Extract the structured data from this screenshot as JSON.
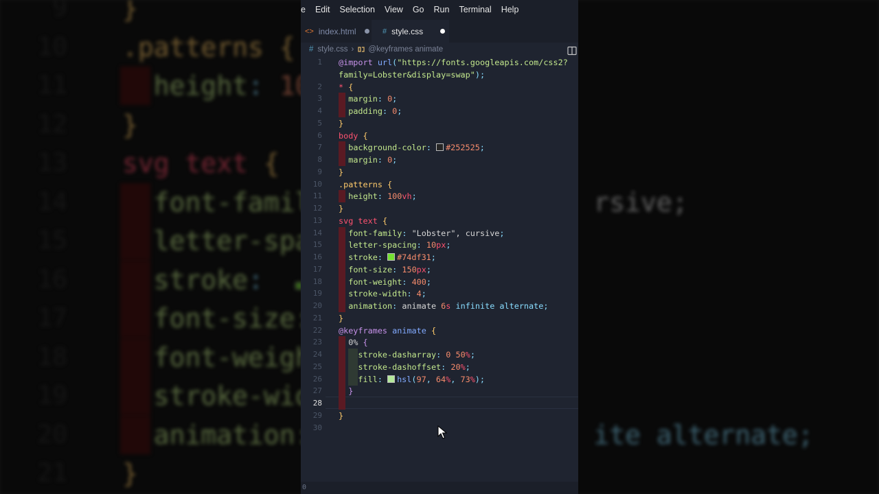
{
  "menu": [
    "e",
    "Edit",
    "Selection",
    "View",
    "Go",
    "Run",
    "Terminal",
    "Help"
  ],
  "tabs": [
    {
      "label": "index.html",
      "icon": "<>",
      "dot_color": "#8a93a8"
    },
    {
      "label": "style.css",
      "icon": "#",
      "dot_color": "#ffffff"
    }
  ],
  "breadcrumb": {
    "file": "style.css",
    "symbol": "@keyframes animate"
  },
  "current_line": 28,
  "status": {
    "left": "0"
  },
  "colors": {
    "editor_bg": "#1f2430",
    "accent": "#ffcb6b",
    "swatch_bg": "#252525",
    "swatch_stroke": "#74df31",
    "swatch_fill": "#b4e89a"
  },
  "code_lines": [
    {
      "n": "1",
      "t": [
        [
          "t-at",
          "@import"
        ],
        [
          "t-txt",
          " "
        ],
        [
          "t-fn",
          "url"
        ],
        [
          "t-pun",
          "("
        ],
        [
          "t-str",
          "\"https://fonts.googleapis.com/css2?"
        ]
      ]
    },
    {
      "n": "",
      "t": [
        [
          "t-str",
          "family=Lobster&display=swap\""
        ],
        [
          "t-pun",
          ");"
        ]
      ]
    },
    {
      "n": "2",
      "t": [
        [
          "t-sel",
          "*"
        ],
        [
          "t-txt",
          " "
        ],
        [
          "t-br",
          "{"
        ]
      ]
    },
    {
      "n": "3",
      "t": [
        [
          "t-txt",
          "  "
        ],
        [
          "t-prop",
          "margin"
        ],
        [
          "t-pun",
          ":"
        ],
        [
          "t-txt",
          " "
        ],
        [
          "t-num",
          "0"
        ],
        [
          "t-pun",
          ";"
        ]
      ]
    },
    {
      "n": "4",
      "t": [
        [
          "t-txt",
          "  "
        ],
        [
          "t-prop",
          "padding"
        ],
        [
          "t-pun",
          ":"
        ],
        [
          "t-txt",
          " "
        ],
        [
          "t-num",
          "0"
        ],
        [
          "t-pun",
          ";"
        ]
      ]
    },
    {
      "n": "5",
      "t": [
        [
          "t-br",
          "}"
        ]
      ]
    },
    {
      "n": "6",
      "t": [
        [
          "t-sel",
          "body"
        ],
        [
          "t-txt",
          " "
        ],
        [
          "t-br",
          "{"
        ]
      ]
    },
    {
      "n": "7",
      "t": [
        [
          "t-txt",
          "  "
        ],
        [
          "t-prop",
          "background-color"
        ],
        [
          "t-pun",
          ":"
        ],
        [
          "t-txt",
          " "
        ],
        [
          "sw",
          "#252525"
        ],
        [
          "t-num",
          "#252525"
        ],
        [
          "t-pun",
          ";"
        ]
      ]
    },
    {
      "n": "8",
      "t": [
        [
          "t-txt",
          "  "
        ],
        [
          "t-prop",
          "margin"
        ],
        [
          "t-pun",
          ":"
        ],
        [
          "t-txt",
          " "
        ],
        [
          "t-num",
          "0"
        ],
        [
          "t-pun",
          ";"
        ]
      ]
    },
    {
      "n": "9",
      "t": [
        [
          "t-br",
          "}"
        ]
      ]
    },
    {
      "n": "10",
      "t": [
        [
          "t-cls",
          ".patterns"
        ],
        [
          "t-txt",
          " "
        ],
        [
          "t-br",
          "{"
        ]
      ]
    },
    {
      "n": "11",
      "t": [
        [
          "t-txt",
          "  "
        ],
        [
          "t-prop",
          "height"
        ],
        [
          "t-pun",
          ":"
        ],
        [
          "t-txt",
          " "
        ],
        [
          "t-num",
          "100"
        ],
        [
          "t-sel",
          "vh"
        ],
        [
          "t-pun",
          ";"
        ]
      ]
    },
    {
      "n": "12",
      "t": [
        [
          "t-br",
          "}"
        ]
      ]
    },
    {
      "n": "13",
      "t": [
        [
          "t-sel",
          "svg"
        ],
        [
          "t-txt",
          " "
        ],
        [
          "t-sel",
          "text"
        ],
        [
          "t-txt",
          " "
        ],
        [
          "t-br",
          "{"
        ]
      ]
    },
    {
      "n": "14",
      "t": [
        [
          "t-txt",
          "  "
        ],
        [
          "t-prop",
          "font-family"
        ],
        [
          "t-pun",
          ":"
        ],
        [
          "t-txt",
          " \"Lobster\", cursive"
        ],
        [
          "t-pun",
          ";"
        ]
      ]
    },
    {
      "n": "15",
      "t": [
        [
          "t-txt",
          "  "
        ],
        [
          "t-prop",
          "letter-spacing"
        ],
        [
          "t-pun",
          ":"
        ],
        [
          "t-txt",
          " "
        ],
        [
          "t-num",
          "10"
        ],
        [
          "t-sel",
          "px"
        ],
        [
          "t-pun",
          ";"
        ]
      ]
    },
    {
      "n": "16",
      "t": [
        [
          "t-txt",
          "  "
        ],
        [
          "t-prop",
          "stroke"
        ],
        [
          "t-pun",
          ":"
        ],
        [
          "t-txt",
          " "
        ],
        [
          "sw",
          "#74df31"
        ],
        [
          "t-num",
          "#74df31"
        ],
        [
          "t-pun",
          ";"
        ]
      ]
    },
    {
      "n": "17",
      "t": [
        [
          "t-txt",
          "  "
        ],
        [
          "t-prop",
          "font-size"
        ],
        [
          "t-pun",
          ":"
        ],
        [
          "t-txt",
          " "
        ],
        [
          "t-num",
          "150"
        ],
        [
          "t-sel",
          "px"
        ],
        [
          "t-pun",
          ";"
        ]
      ]
    },
    {
      "n": "18",
      "t": [
        [
          "t-txt",
          "  "
        ],
        [
          "t-prop",
          "font-weight"
        ],
        [
          "t-pun",
          ":"
        ],
        [
          "t-txt",
          " "
        ],
        [
          "t-num",
          "400"
        ],
        [
          "t-pun",
          ";"
        ]
      ]
    },
    {
      "n": "19",
      "t": [
        [
          "t-txt",
          "  "
        ],
        [
          "t-prop",
          "stroke-width"
        ],
        [
          "t-pun",
          ":"
        ],
        [
          "t-txt",
          " "
        ],
        [
          "t-num",
          "4"
        ],
        [
          "t-pun",
          ";"
        ]
      ]
    },
    {
      "n": "20",
      "t": [
        [
          "t-txt",
          "  "
        ],
        [
          "t-prop",
          "animation"
        ],
        [
          "t-pun",
          ":"
        ],
        [
          "t-txt",
          " animate "
        ],
        [
          "t-num",
          "6"
        ],
        [
          "t-sel",
          "s"
        ],
        [
          "t-txt",
          " "
        ],
        [
          "t-kw",
          "infinite alternate"
        ],
        [
          "t-pun",
          ";"
        ]
      ]
    },
    {
      "n": "21",
      "t": [
        [
          "t-br",
          "}"
        ]
      ]
    },
    {
      "n": "22",
      "t": [
        [
          "t-at",
          "@keyframes"
        ],
        [
          "t-txt",
          " "
        ],
        [
          "t-fn",
          "animate"
        ],
        [
          "t-txt",
          " "
        ],
        [
          "t-br",
          "{"
        ]
      ]
    },
    {
      "n": "23",
      "t": [
        [
          "t-txt",
          "  "
        ],
        [
          "t-txt",
          "0%"
        ],
        [
          "t-txt",
          " "
        ],
        [
          "t-br2",
          "{"
        ]
      ]
    },
    {
      "n": "24",
      "t": [
        [
          "t-txt",
          "    "
        ],
        [
          "t-prop",
          "stroke-dasharray"
        ],
        [
          "t-pun",
          ":"
        ],
        [
          "t-txt",
          " "
        ],
        [
          "t-num",
          "0"
        ],
        [
          "t-txt",
          " "
        ],
        [
          "t-num",
          "50"
        ],
        [
          "t-sel",
          "%"
        ],
        [
          "t-pun",
          ";"
        ]
      ]
    },
    {
      "n": "25",
      "t": [
        [
          "t-txt",
          "    "
        ],
        [
          "t-prop",
          "stroke-dashoffset"
        ],
        [
          "t-pun",
          ":"
        ],
        [
          "t-txt",
          " "
        ],
        [
          "t-num",
          "20"
        ],
        [
          "t-sel",
          "%"
        ],
        [
          "t-pun",
          ";"
        ]
      ]
    },
    {
      "n": "26",
      "t": [
        [
          "t-txt",
          "    "
        ],
        [
          "t-prop",
          "fill"
        ],
        [
          "t-pun",
          ":"
        ],
        [
          "t-txt",
          " "
        ],
        [
          "sw",
          "#b4e89a"
        ],
        [
          "t-fn",
          "hsl"
        ],
        [
          "t-pun",
          "("
        ],
        [
          "t-num",
          "97"
        ],
        [
          "t-pun",
          ","
        ],
        [
          "t-txt",
          " "
        ],
        [
          "t-num",
          "64"
        ],
        [
          "t-sel",
          "%"
        ],
        [
          "t-pun",
          ","
        ],
        [
          "t-txt",
          " "
        ],
        [
          "t-num",
          "73"
        ],
        [
          "t-sel",
          "%"
        ],
        [
          "t-pun",
          ");"
        ]
      ]
    },
    {
      "n": "27",
      "t": [
        [
          "t-txt",
          "  "
        ],
        [
          "t-br2",
          "}"
        ]
      ]
    },
    {
      "n": "28",
      "t": []
    },
    {
      "n": "29",
      "t": [
        [
          "t-br",
          "}"
        ]
      ]
    },
    {
      "n": "30",
      "t": []
    }
  ],
  "background_lines": [
    {
      "n": "9",
      "t": [
        [
          "t-br",
          "}"
        ]
      ]
    },
    {
      "n": "10",
      "t": [
        [
          "t-cls",
          ".patterns"
        ],
        [
          "t-txt",
          " "
        ],
        [
          "t-br",
          "{"
        ]
      ]
    },
    {
      "n": "11",
      "t": [
        [
          "t-txt",
          "  "
        ],
        [
          "t-prop",
          "height"
        ],
        [
          "t-pun",
          ":"
        ],
        [
          "t-txt",
          " "
        ],
        [
          "t-num",
          "10"
        ]
      ]
    },
    {
      "n": "12",
      "t": [
        [
          "t-br",
          "}"
        ]
      ]
    },
    {
      "n": "13",
      "t": [
        [
          "t-sel",
          "svg"
        ],
        [
          "t-txt",
          " "
        ],
        [
          "t-sel",
          "text"
        ],
        [
          "t-txt",
          " "
        ],
        [
          "t-br",
          "{"
        ]
      ]
    },
    {
      "n": "14",
      "t": [
        [
          "t-txt",
          "  "
        ],
        [
          "t-prop",
          "font-famil"
        ],
        [
          "t-txt",
          "                  rsive;"
        ]
      ]
    },
    {
      "n": "15",
      "t": [
        [
          "t-txt",
          "  "
        ],
        [
          "t-prop",
          "letter-spa"
        ]
      ]
    },
    {
      "n": "16",
      "t": [
        [
          "t-txt",
          "  "
        ],
        [
          "t-prop",
          "stroke"
        ],
        [
          "t-pun",
          ":"
        ],
        [
          "t-txt",
          "  "
        ],
        [
          "sw",
          "#74df31"
        ]
      ]
    },
    {
      "n": "17",
      "t": [
        [
          "t-txt",
          "  "
        ],
        [
          "t-prop",
          "font-size:"
        ]
      ]
    },
    {
      "n": "18",
      "t": [
        [
          "t-txt",
          "  "
        ],
        [
          "t-prop",
          "font-weigh"
        ]
      ]
    },
    {
      "n": "19",
      "t": [
        [
          "t-txt",
          "  "
        ],
        [
          "t-prop",
          "stroke-wid"
        ]
      ]
    },
    {
      "n": "20",
      "t": [
        [
          "t-txt",
          "  "
        ],
        [
          "t-prop",
          "animation:"
        ],
        [
          "t-txt",
          "                  "
        ],
        [
          "t-kw",
          "ite alternate"
        ],
        [
          "t-pun",
          ";"
        ]
      ]
    },
    {
      "n": "21",
      "t": [
        [
          "t-br",
          "}"
        ]
      ]
    }
  ]
}
